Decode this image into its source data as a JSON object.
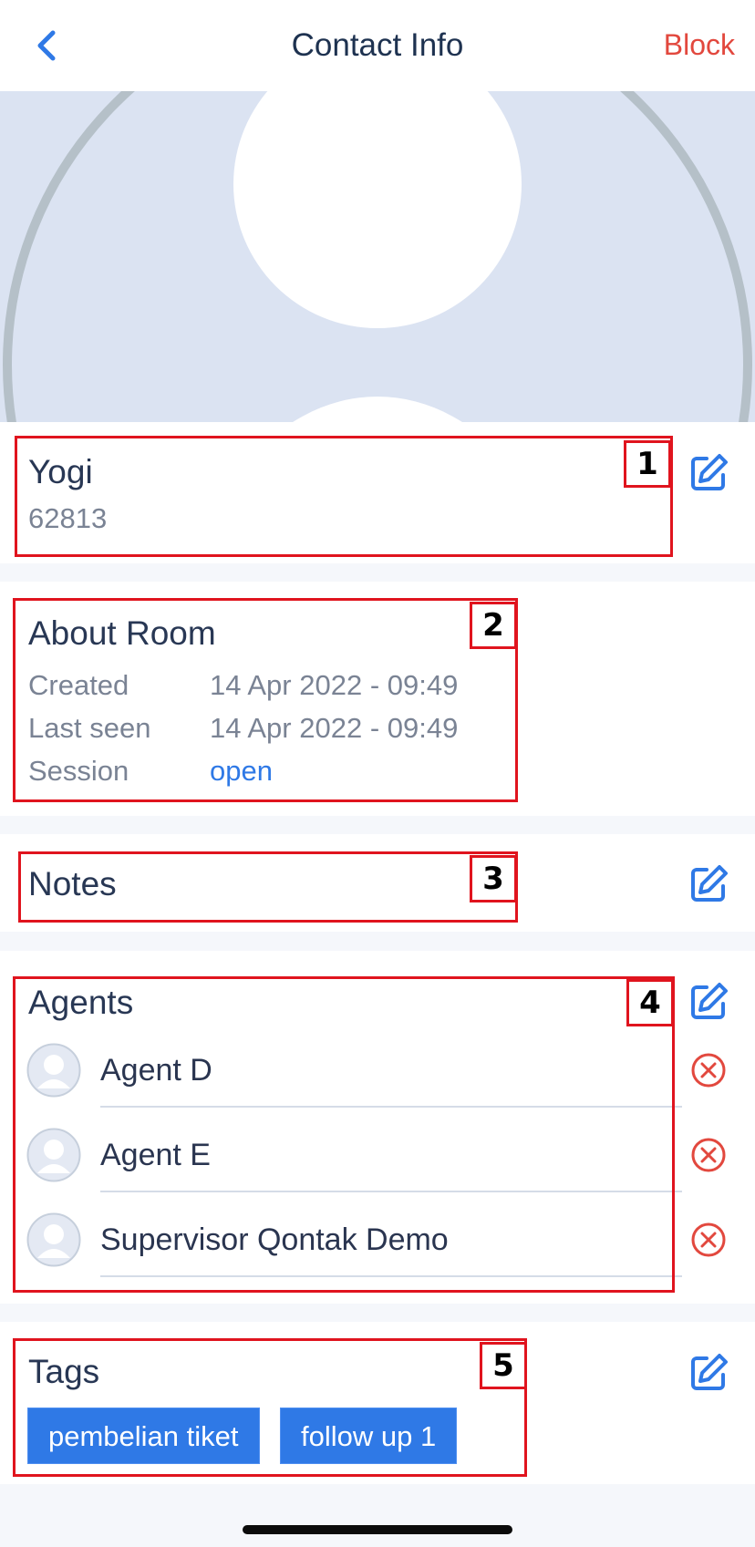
{
  "header": {
    "title": "Contact Info",
    "block_label": "Block"
  },
  "contact": {
    "name": "Yogi",
    "phone": "62813"
  },
  "about_room": {
    "title": "About Room",
    "rows": [
      {
        "label": "Created",
        "value": "14 Apr 2022 - 09:49"
      },
      {
        "label": "Last seen",
        "value": "14 Apr 2022 - 09:49"
      },
      {
        "label": "Session",
        "value": "open"
      }
    ]
  },
  "notes": {
    "title": "Notes"
  },
  "agents": {
    "title": "Agents",
    "items": [
      {
        "name": "Agent D"
      },
      {
        "name": "Agent E"
      },
      {
        "name": "Supervisor Qontak Demo"
      }
    ]
  },
  "tags": {
    "title": "Tags",
    "items": [
      "pembelian tiket",
      "follow up 1"
    ]
  },
  "annotations": [
    "1",
    "2",
    "3",
    "4",
    "5"
  ],
  "colors": {
    "accent": "#2f79e6",
    "danger": "#e2483e",
    "annotation": "#e0141e"
  }
}
